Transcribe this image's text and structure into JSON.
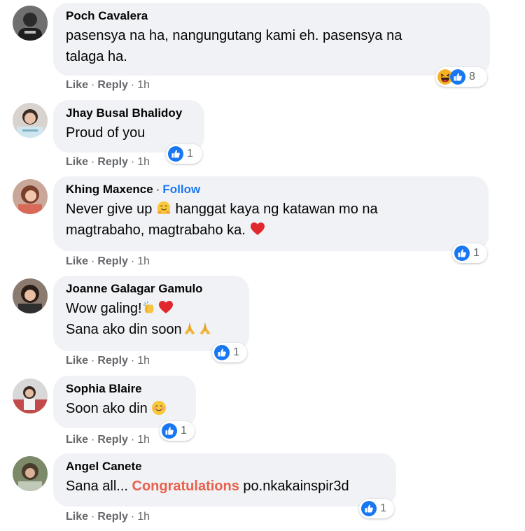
{
  "comments": [
    {
      "name": "Poch Cavalera",
      "lines": [
        "pasensya na ha, nangungutang kami eh. pasensya na",
        "talaga ha."
      ],
      "actions": {
        "like": "Like",
        "reply": "Reply",
        "time": "1h",
        "sep": "·"
      },
      "reaction_count": "8",
      "reactions": [
        "haha-icon",
        "like-icon"
      ]
    },
    {
      "name": "Jhay Busal Bhalidoy",
      "lines": [
        "Proud of you"
      ],
      "actions": {
        "like": "Like",
        "reply": "Reply",
        "time": "1h",
        "sep": "·"
      },
      "reaction_count": "1",
      "reactions": [
        "like-icon"
      ]
    },
    {
      "name": "Khing Maxence",
      "follow": "Follow",
      "dot": "·",
      "lines": [
        "Never give up",
        "hanggat kaya ng katawan mo na",
        "magtrabaho, magtrabaho ka."
      ],
      "actions": {
        "like": "Like",
        "reply": "Reply",
        "time": "1h",
        "sep": "·"
      },
      "reaction_count": "1",
      "reactions": [
        "like-icon"
      ]
    },
    {
      "name": "Joanne Galagar Gamulo",
      "lines": [
        "Wow galing!",
        "Sana ako din soon"
      ],
      "actions": {
        "like": "Like",
        "reply": "Reply",
        "time": "1h",
        "sep": "·"
      },
      "reaction_count": "1",
      "reactions": [
        "like-icon"
      ]
    },
    {
      "name": "Sophia Blaire",
      "lines": [
        "Soon ako din"
      ],
      "actions": {
        "like": "Like",
        "reply": "Reply",
        "time": "1h",
        "sep": "·"
      },
      "reaction_count": "1",
      "reactions": [
        "like-icon"
      ]
    },
    {
      "name": "Angel Canete",
      "lines": [
        "Sana all...",
        "Congratulations",
        "po.nkakainspir3d"
      ],
      "actions": {
        "like": "Like",
        "reply": "Reply",
        "time": "1h",
        "sep": "·"
      },
      "reaction_count": "1",
      "reactions": [
        "like-icon"
      ]
    }
  ],
  "colors": {
    "bubble": "#f0f2f5",
    "meta_text": "#65676b",
    "follow": "#1877f2",
    "congratulations": "#e9604d",
    "like_blue": "#1877f2"
  }
}
